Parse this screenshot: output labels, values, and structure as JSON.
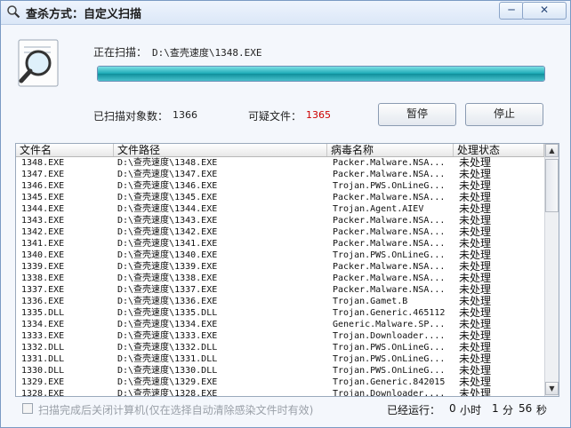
{
  "window": {
    "title": "查杀方式：自定义扫描",
    "min_label": "─",
    "close_label": "✕"
  },
  "scan": {
    "label": "正在扫描：",
    "path": "D:\\查壳速度\\1348.EXE",
    "progress": 1.0,
    "scanned_label": "已扫描对象数：",
    "scanned_count": "1366",
    "suspicious_label": "可疑文件：",
    "suspicious_count": "1365",
    "pause_label": "暂停",
    "stop_label": "停止"
  },
  "table": {
    "headers": [
      "文件名",
      "文件路径",
      "病毒名称",
      "处理状态"
    ],
    "rows": [
      [
        "1348.EXE",
        "D:\\查壳速度\\1348.EXE",
        "Packer.Malware.NSA...",
        "未处理"
      ],
      [
        "1347.EXE",
        "D:\\查壳速度\\1347.EXE",
        "Packer.Malware.NSA...",
        "未处理"
      ],
      [
        "1346.EXE",
        "D:\\查壳速度\\1346.EXE",
        "Trojan.PWS.OnLineG...",
        "未处理"
      ],
      [
        "1345.EXE",
        "D:\\查壳速度\\1345.EXE",
        "Packer.Malware.NSA...",
        "未处理"
      ],
      [
        "1344.EXE",
        "D:\\查壳速度\\1344.EXE",
        "Trojan.Agent.AIEV",
        "未处理"
      ],
      [
        "1343.EXE",
        "D:\\查壳速度\\1343.EXE",
        "Packer.Malware.NSA...",
        "未处理"
      ],
      [
        "1342.EXE",
        "D:\\查壳速度\\1342.EXE",
        "Packer.Malware.NSA...",
        "未处理"
      ],
      [
        "1341.EXE",
        "D:\\查壳速度\\1341.EXE",
        "Packer.Malware.NSA...",
        "未处理"
      ],
      [
        "1340.EXE",
        "D:\\查壳速度\\1340.EXE",
        "Trojan.PWS.OnLineG...",
        "未处理"
      ],
      [
        "1339.EXE",
        "D:\\查壳速度\\1339.EXE",
        "Packer.Malware.NSA...",
        "未处理"
      ],
      [
        "1338.EXE",
        "D:\\查壳速度\\1338.EXE",
        "Packer.Malware.NSA...",
        "未处理"
      ],
      [
        "1337.EXE",
        "D:\\查壳速度\\1337.EXE",
        "Packer.Malware.NSA...",
        "未处理"
      ],
      [
        "1336.EXE",
        "D:\\查壳速度\\1336.EXE",
        "Trojan.Gamet.B",
        "未处理"
      ],
      [
        "1335.DLL",
        "D:\\查壳速度\\1335.DLL",
        "Trojan.Generic.465112",
        "未处理"
      ],
      [
        "1334.EXE",
        "D:\\查壳速度\\1334.EXE",
        "Generic.Malware.SP...",
        "未处理"
      ],
      [
        "1333.EXE",
        "D:\\查壳速度\\1333.EXE",
        "Trojan.Downloader....",
        "未处理"
      ],
      [
        "1332.DLL",
        "D:\\查壳速度\\1332.DLL",
        "Trojan.PWS.OnLineG...",
        "未处理"
      ],
      [
        "1331.DLL",
        "D:\\查壳速度\\1331.DLL",
        "Trojan.PWS.OnLineG...",
        "未处理"
      ],
      [
        "1330.DLL",
        "D:\\查壳速度\\1330.DLL",
        "Trojan.PWS.OnLineG...",
        "未处理"
      ],
      [
        "1329.EXE",
        "D:\\查壳速度\\1329.EXE",
        "Trojan.Generic.842015",
        "未处理"
      ],
      [
        "1328.EXE",
        "D:\\查壳速度\\1328.EXE",
        "Trojan.Downloader....",
        "未处理"
      ]
    ]
  },
  "footer": {
    "shutdown_option": "扫描完成后关闭计算机(仅在选择自动清除感染文件时有效)",
    "elapsed_label": "已经运行：",
    "hours": "0",
    "hours_unit": "小时",
    "minutes": "1",
    "minutes_unit": "分",
    "seconds": "56",
    "seconds_unit": "秒"
  },
  "icons": {
    "title": "magnifier-icon",
    "main": "magnifier-icon",
    "scroll_up": "scroll-up-arrow-icon",
    "scroll_down": "scroll-down-arrow-icon"
  },
  "colors": {
    "suspicious": "#cc0000",
    "progress": "#1aa8b4"
  }
}
